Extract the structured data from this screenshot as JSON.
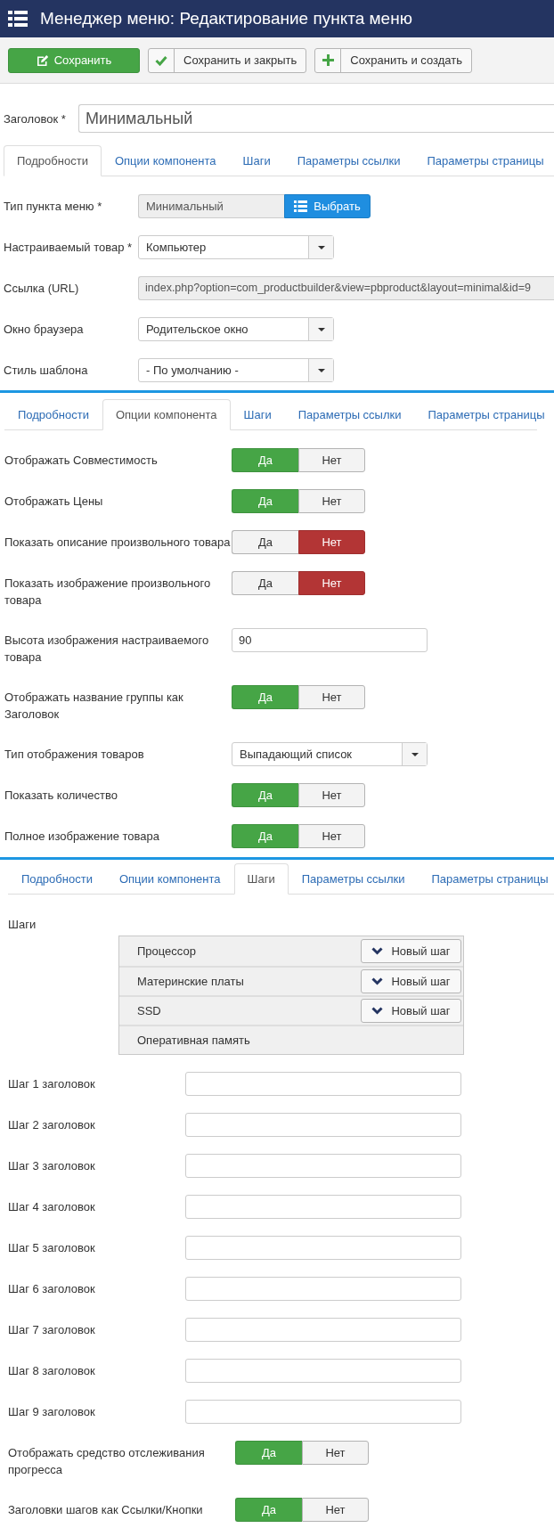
{
  "header": {
    "title": "Менеджер меню: Редактирование пункта меню"
  },
  "toolbar": [
    {
      "kind": "save",
      "label": "Сохранить"
    },
    {
      "kind": "save_close",
      "label": "Сохранить и закрыть"
    },
    {
      "kind": "save_new",
      "label": "Сохранить и создать"
    }
  ],
  "title_field": {
    "label": "Заголовок *",
    "value": "Минимальный"
  },
  "panels": [
    {
      "tabs": [
        {
          "label": "Подробности",
          "selected": true
        },
        {
          "label": "Опции компонента",
          "selected": false
        },
        {
          "label": "Шаги",
          "selected": false
        },
        {
          "label": "Параметры ссылки",
          "selected": false
        },
        {
          "label": "Параметры страницы",
          "selected": false
        }
      ],
      "fields": [
        {
          "kind": "picker",
          "label": "Тип пункта меню *",
          "value": "Минимальный",
          "button": "Выбрать"
        },
        {
          "kind": "select",
          "label": "Настраиваемый товар *",
          "value": "Компьютер"
        },
        {
          "kind": "readonly",
          "label": "Ссылка (URL)",
          "value": "index.php?option=com_productbuilder&view=pbproduct&layout=minimal&id=9"
        },
        {
          "kind": "select",
          "label": "Окно браузера",
          "value": "Родительское окно"
        },
        {
          "kind": "select",
          "label": "Стиль шаблона",
          "value": "- По умолчанию -"
        }
      ]
    },
    {
      "tabs": [
        {
          "label": "Подробности",
          "selected": false
        },
        {
          "label": "Опции компонента",
          "selected": true
        },
        {
          "label": "Шаги",
          "selected": false
        },
        {
          "label": "Параметры ссылки",
          "selected": false
        },
        {
          "label": "Параметры страницы",
          "selected": false
        }
      ],
      "fields": [
        {
          "kind": "toggle",
          "label": "Отображать Совместимость",
          "options": [
            {
              "kind": "yes",
              "label": "Да",
              "selected": true
            },
            {
              "kind": "no",
              "label": "Нет",
              "selected": false
            }
          ]
        },
        {
          "kind": "toggle",
          "label": "Отображать Цены",
          "options": [
            {
              "kind": "yes",
              "label": "Да",
              "selected": true
            },
            {
              "kind": "no",
              "label": "Нет",
              "selected": false
            }
          ]
        },
        {
          "kind": "toggle",
          "label": "Показать описание произвольного товара",
          "options": [
            {
              "kind": "yes",
              "label": "Да",
              "selected": false
            },
            {
              "kind": "no",
              "label": "Нет",
              "selected": true
            }
          ]
        },
        {
          "kind": "toggle",
          "label": "Показать изображение произвольного товара",
          "options": [
            {
              "kind": "yes",
              "label": "Да",
              "selected": false
            },
            {
              "kind": "no",
              "label": "Нет",
              "selected": true
            }
          ]
        },
        {
          "kind": "text",
          "label": "Высота изображения настраиваемого товара",
          "value": "90"
        },
        {
          "kind": "toggle",
          "label": "Отображать название группы как Заголовок",
          "options": [
            {
              "kind": "yes",
              "label": "Да",
              "selected": true
            },
            {
              "kind": "no",
              "label": "Нет",
              "selected": false
            }
          ]
        },
        {
          "kind": "select",
          "label": "Тип отображения товаров",
          "value": "Выпадающий список"
        },
        {
          "kind": "toggle",
          "label": "Показать количество",
          "options": [
            {
              "kind": "yes",
              "label": "Да",
              "selected": true
            },
            {
              "kind": "no",
              "label": "Нет",
              "selected": false
            }
          ]
        },
        {
          "kind": "toggle",
          "label": "Полное изображение товара",
          "options": [
            {
              "kind": "yes",
              "label": "Да",
              "selected": true
            },
            {
              "kind": "no",
              "label": "Нет",
              "selected": false
            }
          ]
        }
      ]
    },
    {
      "tabs": [
        {
          "label": "Подробности",
          "selected": false
        },
        {
          "label": "Опции компонента",
          "selected": false
        },
        {
          "label": "Шаги",
          "selected": true
        },
        {
          "label": "Параметры ссылки",
          "selected": false
        },
        {
          "label": "Параметры страницы",
          "selected": false
        }
      ],
      "fields": [
        {
          "kind": "steps",
          "label": "Шаги",
          "items": [
            {
              "name": "Процессор",
              "button": "Новый шаг"
            },
            {
              "name": "Материнские платы",
              "button": "Новый шаг"
            },
            {
              "name": "SSD",
              "button": "Новый шаг"
            },
            {
              "name": "Оперативная память"
            }
          ]
        },
        {
          "kind": "text",
          "label": "Шаг 1 заголовок"
        },
        {
          "kind": "text",
          "label": "Шаг 2 заголовок"
        },
        {
          "kind": "text",
          "label": "Шаг 3 заголовок"
        },
        {
          "kind": "text",
          "label": "Шаг 4 заголовок"
        },
        {
          "kind": "text",
          "label": "Шаг 5 заголовок"
        },
        {
          "kind": "text",
          "label": "Шаг 6 заголовок"
        },
        {
          "kind": "text",
          "label": "Шаг 7 заголовок"
        },
        {
          "kind": "text",
          "label": "Шаг 8 заголовок"
        },
        {
          "kind": "text",
          "label": "Шаг 9 заголовок"
        },
        {
          "kind": "toggle",
          "label": "Отображать средство отслеживания прогресса",
          "options": [
            {
              "kind": "yes",
              "label": "Да",
              "selected": true
            },
            {
              "kind": "no",
              "label": "Нет",
              "selected": false
            }
          ]
        },
        {
          "kind": "toggle",
          "label": "Заголовки шагов как Ссылки/Кнопки",
          "options": [
            {
              "kind": "yes",
              "label": "Да",
              "selected": true
            },
            {
              "kind": "no",
              "label": "Нет",
              "selected": false
            }
          ]
        }
      ]
    }
  ]
}
